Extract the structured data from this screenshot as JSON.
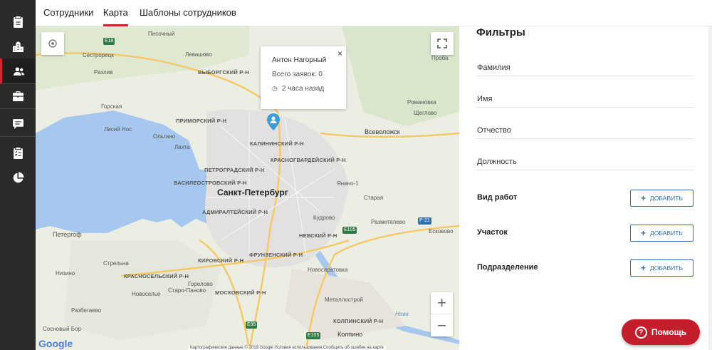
{
  "sidebar": {
    "items": [
      {
        "icon": "clipboard-icon"
      },
      {
        "icon": "buildings-icon"
      },
      {
        "icon": "users-icon",
        "active": true
      },
      {
        "icon": "briefcase-icon"
      },
      {
        "icon": "chat-icon"
      },
      {
        "icon": "checklist-icon"
      },
      {
        "icon": "pie-chart-icon"
      }
    ]
  },
  "tabs": [
    {
      "label": "Сотрудники"
    },
    {
      "label": "Карта",
      "active": true
    },
    {
      "label": "Шаблоны сотрудников"
    }
  ],
  "map": {
    "popup": {
      "name": "Антон Нагорный",
      "requests": "Всего заявок: 0",
      "time": "2 часа назад",
      "close": "×"
    },
    "labels": {
      "city": "Санкт-Петербург",
      "districts": [
        "ВЫБОРГСКИЙ Р-Н",
        "ПРИМОРСКИЙ Р-Н",
        "КАЛИНИНСКИЙ Р-Н",
        "КРАСНОГВАРДЕЙСКИЙ Р-Н",
        "ПЕТРОГРАДСКИЙ Р-Н",
        "ВАСИЛЕОСТРОВСКИЙ Р-Н",
        "АДМИРАЛТЕЙСКИЙ Р-Н",
        "НЕВСКИЙ Р-Н",
        "ФРУНЗЕНСКИЙ Р-Н",
        "КИРОВСКИЙ Р-Н",
        "КРАСНОСЕЛЬСКИЙ Р-Н",
        "МОСКОВСКИЙ Р-Н",
        "КОЛПИНСКИЙ Р-Н"
      ],
      "places": [
        "Песочный",
        "Сестрорецк",
        "Левашово",
        "Разлив",
        "Горская",
        "Лисий Нос",
        "Ольгино",
        "Лахта",
        "Проба",
        "Романовка",
        "Щеглово",
        "Всеволожск",
        "Янино-1",
        "Старая",
        "Кудрово",
        "Разметелево",
        "Есковово",
        "Петергоф",
        "Стрельна",
        "Низино",
        "Горелово",
        "Новоселье",
        "Старо-Паново",
        "Разбегаево",
        "Новосаратовка",
        "Металлострой",
        "Колпино",
        "Сосновый Бор"
      ],
      "water": "Нева",
      "roads": [
        "E18",
        "E105",
        "E95",
        "P-21"
      ]
    },
    "attribution": {
      "logo": "Google",
      "text": "Картографические данные © 2019 Google   Условия использования   Сообщить об ошибке на карте"
    },
    "zoom_in": "+",
    "zoom_out": "−"
  },
  "filters": {
    "title": "Фильтры",
    "fields": [
      {
        "label": "Фамилия"
      },
      {
        "label": "Имя"
      },
      {
        "label": "Отчество"
      },
      {
        "label": "Должность"
      }
    ],
    "groups": [
      {
        "label": "Вид работ",
        "button": "ДОБАВИТЬ"
      },
      {
        "label": "Участок",
        "button": "ДОБАВИТЬ"
      },
      {
        "label": "Подразделение",
        "button": "ДОБАВИТЬ"
      }
    ]
  },
  "help": {
    "label": "Помощь"
  },
  "colors": {
    "accent": "#d0242f",
    "primary": "#2b6fb3",
    "sidebar": "#2a2a2a",
    "help_button": "#c41d2b"
  }
}
